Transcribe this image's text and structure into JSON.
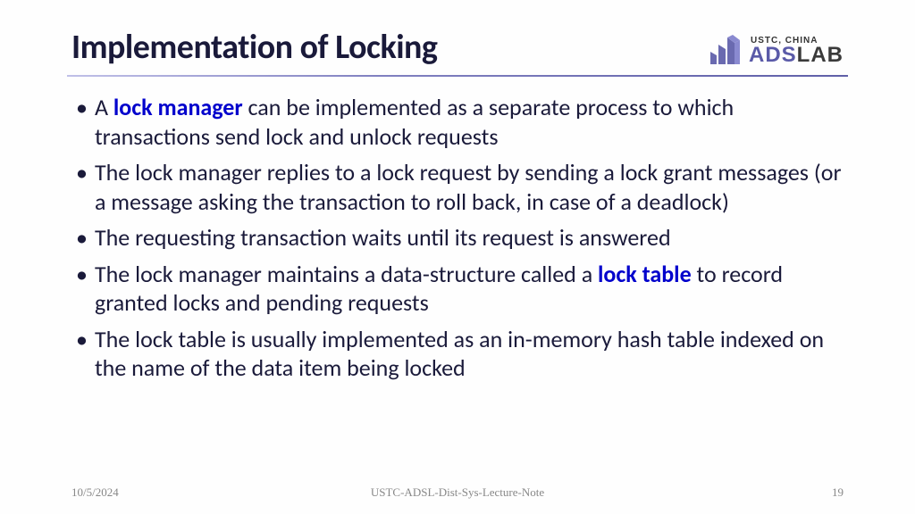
{
  "title": "Implementation of Locking",
  "logo": {
    "subtitle": "USTC, CHINA",
    "part1": "ADS",
    "part2": "LAB"
  },
  "bullets": [
    {
      "pre": "A ",
      "emph": "lock manager",
      "post": " can be implemented as a separate process to which transactions send lock and unlock requests"
    },
    {
      "pre": "The lock manager replies to a lock request by sending a lock grant messages (or a message asking the transaction to roll back, in case of  a deadlock)",
      "emph": "",
      "post": ""
    },
    {
      "pre": "The requesting transaction waits until its request is answered",
      "emph": "",
      "post": ""
    },
    {
      "pre": "The lock manager maintains a data-structure called a ",
      "emph": "lock table",
      "post": " to record granted locks and pending requests"
    },
    {
      "pre": "The lock table is usually implemented as an in-memory hash table indexed on the name of the data item being locked",
      "emph": "",
      "post": ""
    }
  ],
  "footer": {
    "date": "10/5/2024",
    "note": "USTC-ADSL-Dist-Sys-Lecture-Note",
    "page": "19"
  }
}
